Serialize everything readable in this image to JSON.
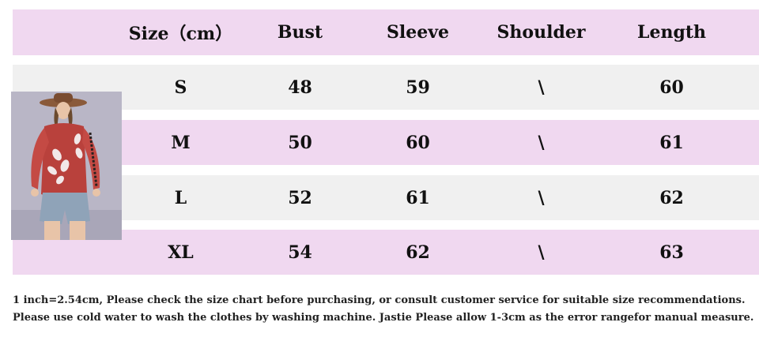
{
  "table": {
    "headers": [
      "Size（cm）",
      "Bust",
      "Sleeve",
      "Shoulder",
      "Length"
    ],
    "rows": [
      [
        "S",
        "48",
        "59",
        "\\",
        "60"
      ],
      [
        "M",
        "50",
        "60",
        "\\",
        "61"
      ],
      [
        "L",
        "52",
        "61",
        "\\",
        "62"
      ],
      [
        "XL",
        "54",
        "62",
        "\\",
        "63"
      ]
    ]
  },
  "notes": {
    "line1": "1 inch=2.54cm, Please check the size chart before purchasing, or consult customer service for suitable size recommendations.",
    "line2": "Please use cold water to wash the clothes by washing machine. Jastie Please allow 1-3cm as the error rangefor manual measure."
  },
  "colors": {
    "header_bg": "#f0d8f0",
    "row_pink": "#f0d8f0",
    "row_gray": "#f0f0f0"
  }
}
